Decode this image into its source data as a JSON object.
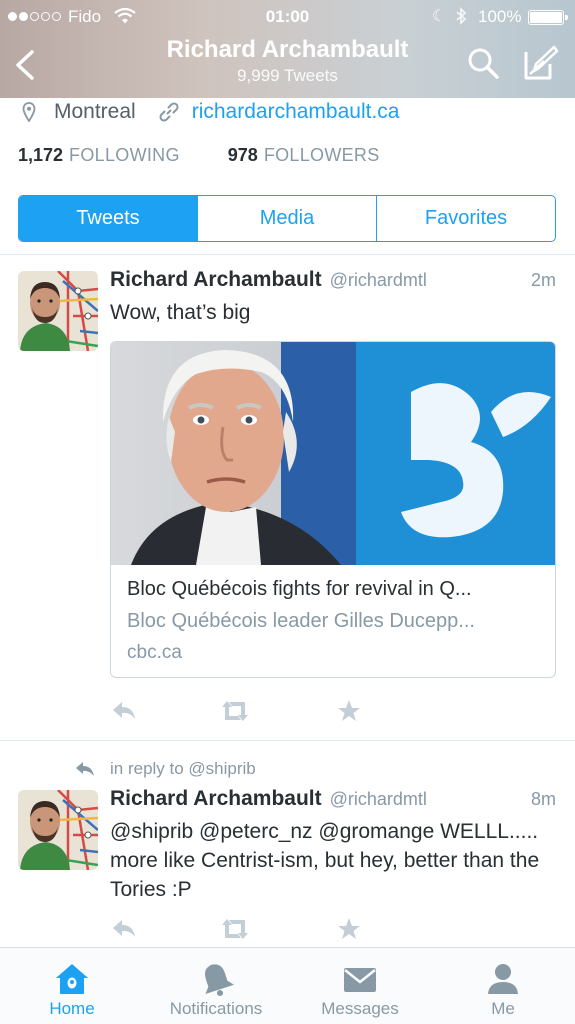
{
  "status_bar": {
    "carrier": "Fido",
    "time": "01:00",
    "battery": "100%"
  },
  "header": {
    "title": "Richard Archambault",
    "subtitle": "9,999 Tweets",
    "back_icon": "chevron-left-icon",
    "search_icon": "search-icon",
    "compose_icon": "compose-icon"
  },
  "profile": {
    "location": "Montreal",
    "website": "richardarchambault.ca",
    "following_count": "1,172",
    "following_label": "FOLLOWING",
    "followers_count": "978",
    "followers_label": "FOLLOWERS"
  },
  "tabs": [
    {
      "label": "Tweets",
      "active": true
    },
    {
      "label": "Media",
      "active": false
    },
    {
      "label": "Favorites",
      "active": false
    }
  ],
  "tweets": [
    {
      "name": "Richard Archambault",
      "handle": "@richardmtl",
      "time": "2m",
      "text": "Wow, that’s big",
      "card": {
        "title": "Bloc Québécois fights for revival in Q...",
        "description": "Bloc Québécois leader Gilles Ducepp...",
        "domain": "cbc.ca"
      }
    },
    {
      "in_reply_to": "in reply to @shiprib",
      "name": "Richard Archambault",
      "handle": "@richardmtl",
      "time": "8m",
      "text": "@shiprib @peterc_nz @gromange WELLL.....  more like Centrist-ism, but hey, better than the Tories :P"
    }
  ],
  "tab_bar": [
    {
      "label": "Home",
      "icon": "home-icon",
      "active": true
    },
    {
      "label": "Notifications",
      "icon": "bell-icon",
      "active": false
    },
    {
      "label": "Messages",
      "icon": "envelope-icon",
      "active": false
    },
    {
      "label": "Me",
      "icon": "person-icon",
      "active": false
    }
  ],
  "colors": {
    "accent": "#1da1f2",
    "muted": "#8899a6",
    "text": "#292f33"
  }
}
